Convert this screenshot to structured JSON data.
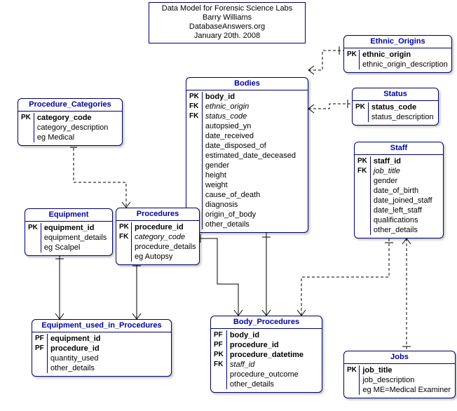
{
  "titlebox": {
    "line1": "Data Model for Forensic Science Labs",
    "line2": "Barry Williams",
    "line3": "DatabaseAnswers.org",
    "line4": "January 20th. 2008"
  },
  "entities": {
    "ethnic_origins": {
      "title": "Ethnic_Origins",
      "rows": [
        {
          "key": "PK",
          "name": "ethnic_origin",
          "cls": "pk"
        },
        {
          "key": "",
          "name": "ethnic_origin_description",
          "cls": ""
        }
      ]
    },
    "status": {
      "title": "Status",
      "rows": [
        {
          "key": "PK",
          "name": "status_code",
          "cls": "pk"
        },
        {
          "key": "",
          "name": "status_description",
          "cls": ""
        }
      ]
    },
    "procedure_categories": {
      "title": "Procedure_Categories",
      "rows": [
        {
          "key": "PK",
          "name": "category_code",
          "cls": "pk"
        },
        {
          "key": "",
          "name": "category_description",
          "cls": ""
        },
        {
          "key": "",
          "name": "eg Medical",
          "cls": "eg"
        }
      ]
    },
    "bodies": {
      "title": "Bodies",
      "rows": [
        {
          "key": "PK",
          "name": "body_id",
          "cls": "pk"
        },
        {
          "key": "FK",
          "name": "ethnic_origin",
          "cls": "fk"
        },
        {
          "key": "FK",
          "name": "status_code",
          "cls": "fk"
        },
        {
          "key": "",
          "name": "autopsied_yn",
          "cls": ""
        },
        {
          "key": "",
          "name": "date_received",
          "cls": ""
        },
        {
          "key": "",
          "name": "date_disposed_of",
          "cls": ""
        },
        {
          "key": "",
          "name": "estimated_date_deceased",
          "cls": ""
        },
        {
          "key": "",
          "name": "gender",
          "cls": ""
        },
        {
          "key": "",
          "name": "height",
          "cls": ""
        },
        {
          "key": "",
          "name": "weight",
          "cls": ""
        },
        {
          "key": "",
          "name": "cause_of_death",
          "cls": ""
        },
        {
          "key": "",
          "name": "diagnosis",
          "cls": ""
        },
        {
          "key": "",
          "name": "origin_of_body",
          "cls": ""
        },
        {
          "key": "",
          "name": "other_details",
          "cls": ""
        }
      ]
    },
    "staff": {
      "title": "Staff",
      "rows": [
        {
          "key": "PK",
          "name": "staff_id",
          "cls": "pk"
        },
        {
          "key": "FK",
          "name": "job_title",
          "cls": "fk"
        },
        {
          "key": "",
          "name": "gender",
          "cls": ""
        },
        {
          "key": "",
          "name": "date_of_birth",
          "cls": ""
        },
        {
          "key": "",
          "name": "date_joined_staff",
          "cls": ""
        },
        {
          "key": "",
          "name": "date_left_staff",
          "cls": ""
        },
        {
          "key": "",
          "name": "qualifications",
          "cls": ""
        },
        {
          "key": "",
          "name": "other_details",
          "cls": ""
        }
      ]
    },
    "equipment": {
      "title": "Equipment",
      "rows": [
        {
          "key": "PK",
          "name": "equipment_id",
          "cls": "pk"
        },
        {
          "key": "",
          "name": "equipment_details",
          "cls": ""
        },
        {
          "key": "",
          "name": "eg Scalpel",
          "cls": "eg"
        }
      ]
    },
    "procedures": {
      "title": "Procedures",
      "rows": [
        {
          "key": "PK",
          "name": "procedure_id",
          "cls": "pk"
        },
        {
          "key": "FK",
          "name": "category_code",
          "cls": "fk"
        },
        {
          "key": "",
          "name": "procedure_details",
          "cls": ""
        },
        {
          "key": "",
          "name": "eg Autopsy",
          "cls": "eg"
        }
      ]
    },
    "equipment_used": {
      "title": "Equipment_used_in_Procedures",
      "rows": [
        {
          "key": "PF",
          "name": "equipment_id",
          "cls": "pk"
        },
        {
          "key": "PF",
          "name": "procedure_id",
          "cls": "pk"
        },
        {
          "key": "",
          "name": "quantity_used",
          "cls": ""
        },
        {
          "key": "",
          "name": "other_details",
          "cls": ""
        }
      ]
    },
    "body_procedures": {
      "title": "Body_Procedures",
      "rows": [
        {
          "key": "PF",
          "name": "body_id",
          "cls": "pk"
        },
        {
          "key": "PF",
          "name": "procedure_id",
          "cls": "pk"
        },
        {
          "key": "PK",
          "name": "procedure_datetime",
          "cls": "pk"
        },
        {
          "key": "FK",
          "name": "staff_id",
          "cls": "fk"
        },
        {
          "key": "",
          "name": "procedure_outcome",
          "cls": ""
        },
        {
          "key": "",
          "name": "other_details",
          "cls": ""
        }
      ]
    },
    "jobs": {
      "title": "Jobs",
      "rows": [
        {
          "key": "PK",
          "name": "job_title",
          "cls": "pk"
        },
        {
          "key": "",
          "name": "job_description",
          "cls": ""
        },
        {
          "key": "",
          "name": "eg ME=Medical Examiner",
          "cls": "eg"
        }
      ]
    }
  }
}
